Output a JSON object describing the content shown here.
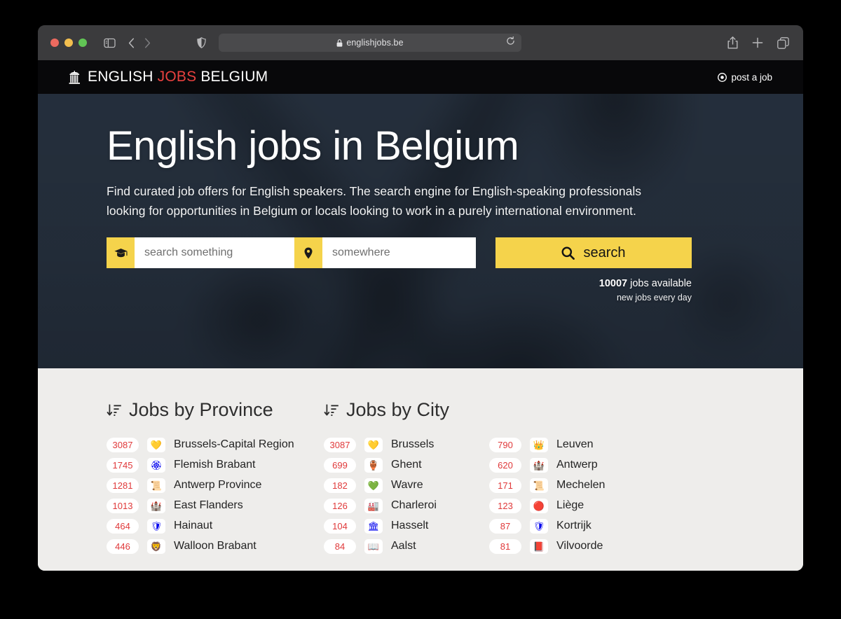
{
  "browser": {
    "url": "englishjobs.be",
    "lock_icon": "lock-icon",
    "reload_icon": "reload-icon",
    "sidebar_icon": "sidebar-toggle-icon",
    "back_icon": "chevron-left-icon",
    "forward_icon": "chevron-right-icon",
    "shield_icon": "privacy-shield-icon",
    "share_icon": "share-icon",
    "new_tab_icon": "plus-icon",
    "tabs_icon": "tab-overview-icon"
  },
  "nav": {
    "logo_icon": "monument-building-icon",
    "brand_part1": "ENGLISH",
    "brand_part2": "JOBS",
    "brand_part3": "BELGIUM",
    "post_job_icon": "plus-circle-icon",
    "post_job_label": "post a job"
  },
  "hero": {
    "title": "English jobs in Belgium",
    "subtitle": "Find curated job offers for English speakers. The search engine for English-speaking professionals looking for opportunities in Belgium or locals looking to work in a purely international environment.",
    "search_what": {
      "icon": "graduation-cap-icon",
      "placeholder": "search something",
      "value": ""
    },
    "search_where": {
      "icon": "map-pin-icon",
      "placeholder": "somewhere",
      "value": ""
    },
    "search_button": {
      "icon": "search-icon",
      "label": "search"
    },
    "jobs_count": "10007",
    "jobs_available_label": " jobs available",
    "jobs_tagline": "new jobs every day"
  },
  "sections": {
    "province": {
      "icon": "sort-descending-icon",
      "heading": "Jobs by Province",
      "items": [
        {
          "count": "3087",
          "flag": "💛",
          "name": "Brussels-Capital Region"
        },
        {
          "count": "1745",
          "flag": "🏵",
          "name": "Flemish Brabant"
        },
        {
          "count": "1281",
          "flag": "📜",
          "name": "Antwerp Province"
        },
        {
          "count": "1013",
          "flag": "🏰",
          "name": "East Flanders"
        },
        {
          "count": "464",
          "flag": "🛡",
          "name": "Hainaut"
        },
        {
          "count": "446",
          "flag": "🦁",
          "name": "Walloon Brabant"
        }
      ]
    },
    "city": {
      "icon": "sort-descending-icon",
      "heading": "Jobs by City",
      "column1": [
        {
          "count": "3087",
          "flag": "💛",
          "name": "Brussels"
        },
        {
          "count": "699",
          "flag": "🏺",
          "name": "Ghent"
        },
        {
          "count": "182",
          "flag": "💚",
          "name": "Wavre"
        },
        {
          "count": "126",
          "flag": "🏭",
          "name": "Charleroi"
        },
        {
          "count": "104",
          "flag": "🏛",
          "name": "Hasselt"
        },
        {
          "count": "84",
          "flag": "📖",
          "name": "Aalst"
        }
      ],
      "column2": [
        {
          "count": "790",
          "flag": "👑",
          "name": "Leuven"
        },
        {
          "count": "620",
          "flag": "🏰",
          "name": "Antwerp"
        },
        {
          "count": "171",
          "flag": "📜",
          "name": "Mechelen"
        },
        {
          "count": "123",
          "flag": "🔴",
          "name": "Liège"
        },
        {
          "count": "87",
          "flag": "🛡",
          "name": "Kortrijk"
        },
        {
          "count": "81",
          "flag": "📕",
          "name": "Vilvoorde"
        }
      ]
    }
  },
  "colors": {
    "accent_yellow": "#f5d34b",
    "brand_red": "#e8413f",
    "count_red": "#e0393a",
    "hero_navy": "#2a3442",
    "page_bg": "#eeedeb",
    "nav_black": "#08080a"
  }
}
